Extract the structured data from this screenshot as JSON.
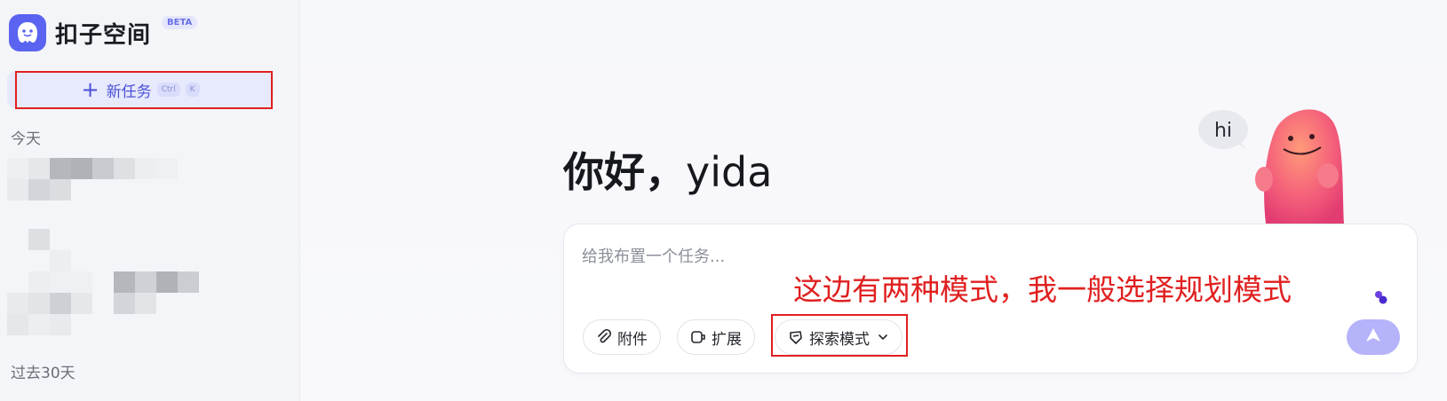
{
  "brand": {
    "name": "扣子空间",
    "badge": "BETA"
  },
  "sidebar": {
    "new_task": {
      "label": "新任务",
      "shortcut_ctrl": "Ctrl",
      "shortcut_key": "K"
    },
    "section_today": "今天",
    "section_past30": "过去30天"
  },
  "main": {
    "greeting_hello": "你好，",
    "greeting_name": "yida",
    "mascot_bubble": "hi",
    "input_placeholder": "给我布置一个任务...",
    "annotation": "这边有两种模式，我一般选择规划模式",
    "buttons": {
      "attach": "附件",
      "extend": "扩展",
      "mode": "探索模式"
    }
  },
  "colors": {
    "accent": "#5a64f0",
    "annotation_red": "#e02020",
    "send_button": "#b5b3fa"
  },
  "icons": [
    "logo-icon",
    "plus-icon",
    "paperclip-icon",
    "extension-icon",
    "explore-icon",
    "chevron-down-icon",
    "send-icon"
  ]
}
